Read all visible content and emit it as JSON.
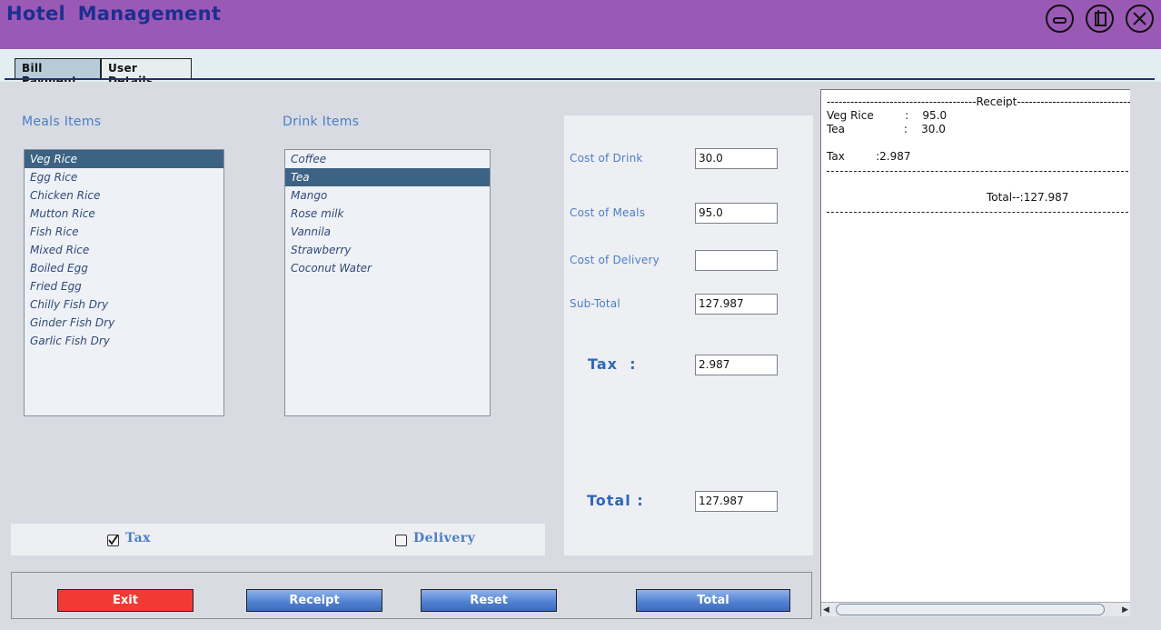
{
  "window": {
    "title": "Hotel  Management"
  },
  "tabs": [
    {
      "label": "Bill Payment",
      "active": true
    },
    {
      "label": "User Details",
      "active": false
    }
  ],
  "meals": {
    "label": "Meals Items",
    "items": [
      "Veg Rice",
      "Egg Rice",
      "Chicken Rice",
      "Mutton Rice",
      "Fish Rice",
      "Mixed Rice",
      "Boiled Egg",
      "Fried Egg",
      "Chilly Fish Dry",
      "Ginder Fish Dry",
      "Garlic Fish Dry"
    ],
    "selected": "Veg Rice"
  },
  "drinks": {
    "label": "Drink Items",
    "items": [
      "Coffee",
      "Tea",
      "Mango",
      "Rose milk",
      "Vannila",
      "Strawberry",
      "Coconut Water"
    ],
    "selected": "Tea"
  },
  "options": {
    "tax": {
      "label": "Tax",
      "checked": true
    },
    "delivery": {
      "label": "Delivery",
      "checked": false
    }
  },
  "costs": {
    "drink": {
      "label": "Cost of Drink",
      "value": "30.0"
    },
    "meals": {
      "label": "Cost of Meals",
      "value": "95.0"
    },
    "delivery": {
      "label": "Cost of Delivery",
      "value": ""
    },
    "subtotal": {
      "label": "Sub-Total",
      "value": "127.987"
    },
    "tax": {
      "label": "Tax  :",
      "value": "2.987"
    },
    "total": {
      "label": "Total :",
      "value": "127.987"
    }
  },
  "buttons": {
    "exit": "Exit",
    "receipt": "Receipt",
    "reset": "Reset",
    "total": "Total"
  },
  "receipt": {
    "header": "--------------------------------------Receipt--------------------------------",
    "line1": "Veg Rice         :    95.0",
    "line2": "Tea                 :    30.0",
    "tax_line": "Tax         :2.987",
    "total_line": "Total--:127.987"
  },
  "colors": {
    "titlebar": "#9b59b6",
    "accent_text": "#4a7ec8",
    "selected_row": "#3c6384",
    "exit_button": "#f23a35",
    "action_button": "#4f7fd0"
  }
}
